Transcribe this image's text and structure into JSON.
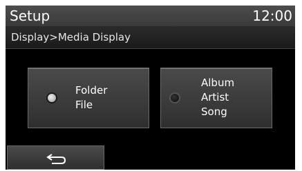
{
  "header": {
    "title": "Setup",
    "clock": "12:00"
  },
  "breadcrumb": {
    "text": "Display>Media Display"
  },
  "options": [
    {
      "lines": [
        "Folder",
        "File"
      ],
      "selected": true
    },
    {
      "lines": [
        "Album",
        "Artist",
        "Song"
      ],
      "selected": false
    }
  ],
  "footer": {
    "back_icon": "back-arrow-icon"
  },
  "colors": {
    "background": "#000000",
    "title_bar": "#444444",
    "button": "#3c3c3c",
    "text": "#ffffff"
  }
}
